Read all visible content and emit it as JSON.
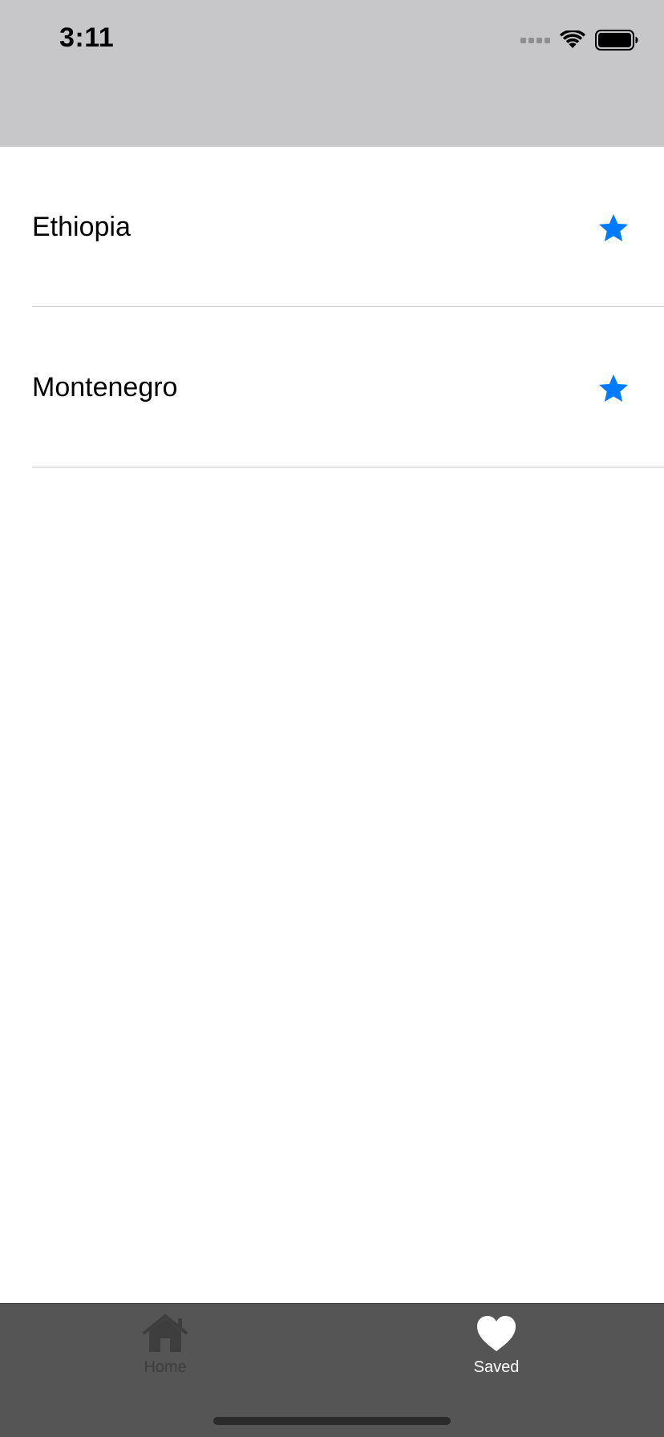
{
  "status_bar": {
    "time": "3:11"
  },
  "list": {
    "items": [
      {
        "label": "Ethiopia",
        "icon": "star-filled-icon"
      },
      {
        "label": "Montenegro",
        "icon": "star-filled-icon"
      }
    ]
  },
  "tabbar": {
    "tabs": [
      {
        "label": "Home",
        "icon": "house-icon",
        "selected": false
      },
      {
        "label": "Saved",
        "icon": "heart-icon",
        "selected": true
      }
    ]
  },
  "colors": {
    "accent": "#007aff",
    "header_bg": "#c7c7c9",
    "tabbar_bg": "#555555",
    "tab_selected": "#ffffff",
    "tab_unselected": "#3e3e3e"
  }
}
